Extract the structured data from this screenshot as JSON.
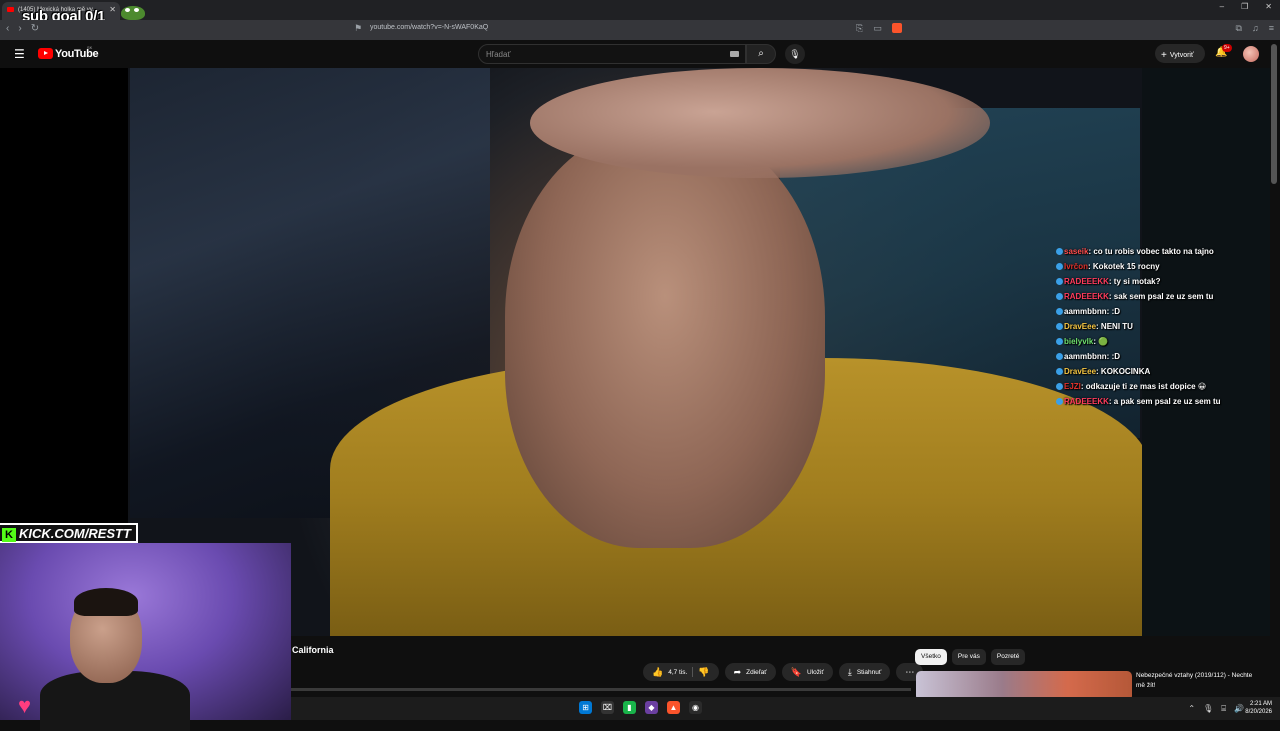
{
  "browser": {
    "tab_title": "(1405) Mexická holka mě vy...",
    "url": "youtube.com/watch?v=-N-sWAF0KaQ"
  },
  "overlay": {
    "sub_goal": "sub goal 0/1",
    "kick_label": "KICK.COM/RESTT"
  },
  "youtube": {
    "logo_text": "YouTube",
    "country_code": "SK",
    "search_placeholder": "Hľadať",
    "create_label": "Vytvoriť",
    "notif_count": "9+"
  },
  "chat": [
    {
      "user": "saseik",
      "text": "co tu robis vobec takto na tajno",
      "color": "#ff4d4d"
    },
    {
      "user": "Ivrčon",
      "text": "Kokotek 15 rocny",
      "color": "#e0312b"
    },
    {
      "user": "RADEEEKK",
      "text": "ty si motak?",
      "color": "#ff3b5c"
    },
    {
      "user": "RADEEEKK",
      "text": "sak sem psal ze uz sem tu",
      "color": "#ff3b5c"
    },
    {
      "user": "aammbbnn",
      "text": ":D",
      "color": "#ffffff"
    },
    {
      "user": "DravEee",
      "text": "NENI TU",
      "color": "#f5c542"
    },
    {
      "user": "bielyvlk",
      "text": "🟢",
      "color": "#6ee06e"
    },
    {
      "user": "aammbbnn",
      "text": ":D",
      "color": "#ffffff"
    },
    {
      "user": "DravEee",
      "text": "KOKOCINKA",
      "color": "#f5c542"
    },
    {
      "user": "EJZI",
      "text": "odkazuje ti ze mas ist dopice 😀",
      "color": "#e0312b"
    },
    {
      "user": "RADEEEKK",
      "text": "a pak sem psal ze uz sem tu",
      "color": "#ff3b5c"
    }
  ],
  "video": {
    "title": "California",
    "likes": "4,7 tis.",
    "share_label": "Zdieľať",
    "save_label": "Uložiť",
    "download_label": "Stiahnuť"
  },
  "sidebar": {
    "chips": [
      "Všetko",
      "Pre vás",
      "Pozreté"
    ],
    "rec_title": "Nebezpečné vztahy (2019/112) - Nechte mě žít!"
  },
  "taskbar": {
    "time": "2:21 AM",
    "date": "8/20/2026"
  },
  "icons": {
    "youtube_brand_color": "#ff0000",
    "kick_brand_color": "#53fc18"
  }
}
